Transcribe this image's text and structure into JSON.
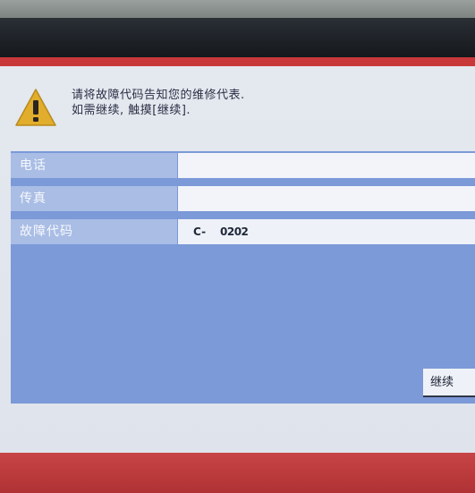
{
  "dialog": {
    "message_line1": "请将故障代码告知您的维修代表.",
    "message_line2": "如需继续, 触摸[继续].",
    "icon": "warning-icon"
  },
  "fields": [
    {
      "label": "电话",
      "value": ""
    },
    {
      "label": "传真",
      "value": ""
    },
    {
      "label": "故障代码",
      "code_prefix": "C-",
      "code_number": "0202"
    }
  ],
  "buttons": {
    "continue_label": "继续"
  },
  "colors": {
    "panel": "#e2e6ee",
    "content": "#7c99d8",
    "label_bg": "#a9bde5",
    "frame_red": "#c8383a",
    "warning_yellow": "#e1ad2c"
  }
}
